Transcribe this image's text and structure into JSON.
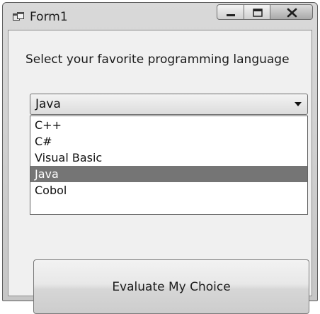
{
  "window": {
    "title": "Form1"
  },
  "form": {
    "prompt": "Select your favorite programming language",
    "combo": {
      "selected": "Java",
      "options": [
        "C++",
        "C#",
        "Visual Basic",
        "Java",
        "Cobol"
      ]
    },
    "button_label": "Evaluate My Choice"
  },
  "icons": {
    "app": "form-window-icon",
    "minimize": "minimize-icon",
    "maximize": "maximize-icon",
    "close": "close-icon",
    "dropdown": "chevron-down-icon"
  },
  "colors": {
    "selection_highlight": "#757575"
  }
}
